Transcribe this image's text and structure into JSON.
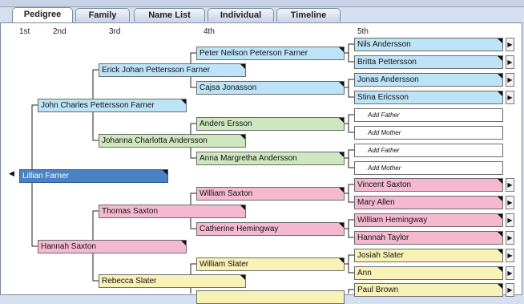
{
  "tabs": [
    {
      "label": "Pedigree",
      "active": true
    },
    {
      "label": "Family"
    },
    {
      "label": "Name List"
    },
    {
      "label": "Individual"
    },
    {
      "label": "Timeline"
    }
  ],
  "generations": [
    "1st",
    "2nd",
    "3rd",
    "4th",
    "5th"
  ],
  "gen1": {
    "name": "Lillian Farner"
  },
  "gen2": [
    "John Charles Pettersson Farner",
    "Hannah Saxton"
  ],
  "gen3": [
    "Erick Johan Pettersson Farner",
    "Johanna Charlotta Andersson",
    "Thomas Saxton",
    "Rebecca Slater"
  ],
  "gen4": [
    "Peter Neilson Peterson Farner",
    "Cajsa Jonasson",
    "Anders Ersson",
    "Anna Margretha Andersson",
    "William Saxton",
    "Catherine Hemingway",
    "William Slater",
    ""
  ],
  "gen5": [
    "Nils Andersson",
    "Britta Pettersson",
    "Jonas Andersson",
    "Stina Ericsson",
    "Add Father",
    "Add Mother",
    "Add Father",
    "Add Mother",
    "Vincent Saxton",
    "Mary Allen",
    "William Hemingway",
    "Hannah Taylor",
    "Josiah Slater",
    "Ann",
    "Paul Brown"
  ],
  "colors": {
    "paternal_paternal": "#bde3f7",
    "paternal_maternal": "#cfe7bf",
    "maternal_paternal": "#f5b9cf",
    "maternal_maternal": "#f8f2b6",
    "selected": "#4a82c3"
  }
}
